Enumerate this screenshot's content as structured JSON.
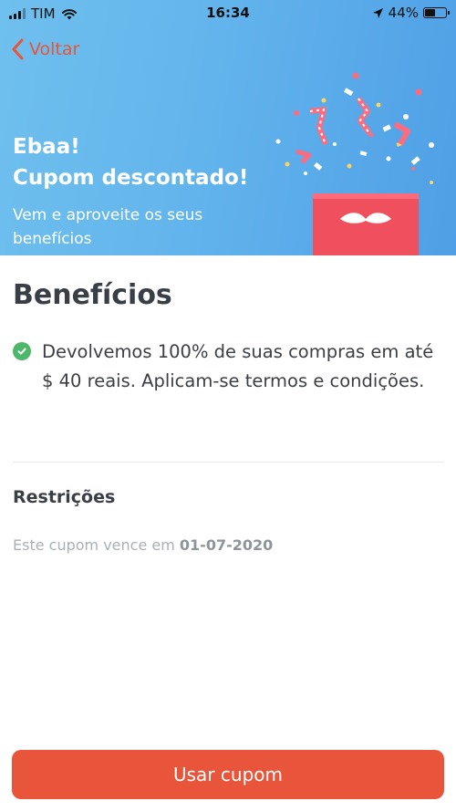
{
  "status_bar": {
    "carrier": "TIM",
    "time": "16:34",
    "battery": "44%",
    "battery_level": 0.44
  },
  "nav": {
    "back_label": "Voltar"
  },
  "hero": {
    "title_line1": "Ebaa!",
    "title_line2": "Cupom descontado!",
    "subtitle": "Vem e aproveite os seus benefícios"
  },
  "benefits": {
    "title": "Benefícios",
    "items": [
      {
        "text": "Devolvemos 100% de suas compras em até $ 40 reais. Aplicam-se termos e condições."
      }
    ]
  },
  "restrictions": {
    "title": "Restrições",
    "expiry_prefix": "Este cupom vence em",
    "expiry_date": "01-07-2020"
  },
  "cta": {
    "label": "Usar cupom"
  },
  "colors": {
    "accent": "#e8553a",
    "hero_gradient_start": "#6fc0ee",
    "hero_gradient_end": "#4f9fe6",
    "check_green": "#4db86b"
  }
}
